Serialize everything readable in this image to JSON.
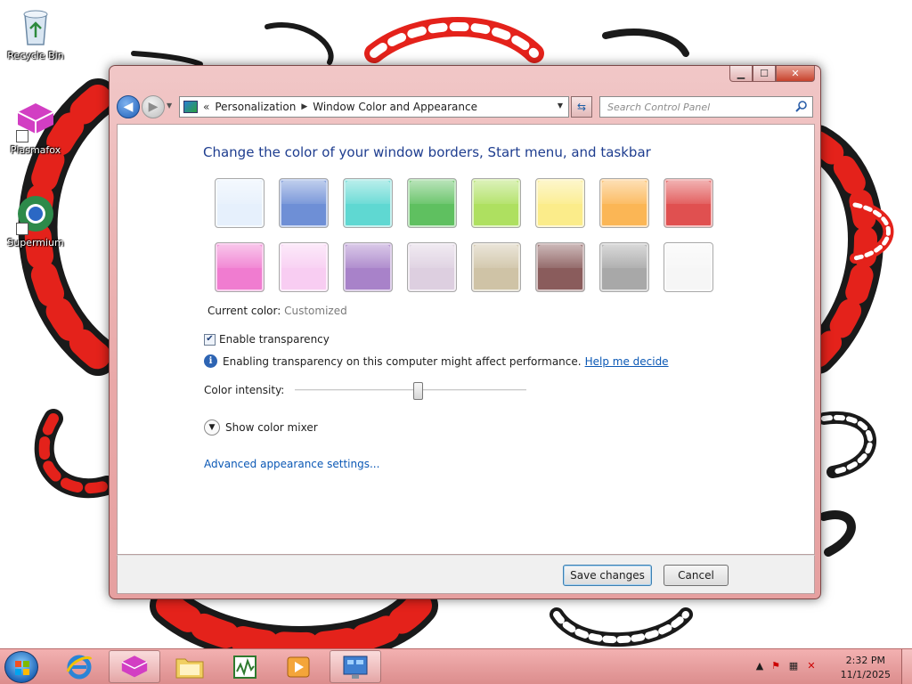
{
  "desktop": {
    "icons": [
      {
        "label": "Recycle Bin",
        "icon": "recycle-bin-icon"
      },
      {
        "label": "Plasmafox",
        "icon": "plasmafox-icon"
      },
      {
        "label": "Supermium",
        "icon": "supermium-icon"
      }
    ]
  },
  "window": {
    "controls": {
      "minimize": "▁",
      "maximize": "☐",
      "close": "✕"
    },
    "nav": {
      "breadcrumb_root": "Personalization",
      "breadcrumb_current": "Window Color and Appearance",
      "search_placeholder": "Search Control Panel"
    },
    "content": {
      "title": "Change the color of your window borders, Start menu, and taskbar",
      "swatch_colors": [
        "#e6f0fc",
        "#6e8fd6",
        "#5fd8d2",
        "#5fc060",
        "#aee060",
        "#fbec8a",
        "#fbb655",
        "#e05050",
        "#f07cd0",
        "#f8cdf2",
        "#a882c9",
        "#ddcfe0",
        "#cfc3a6",
        "#8a5c5c",
        "#a8a8a8",
        "#f6f6f6"
      ],
      "current_color_label": "Current color:",
      "current_color_value": "Customized",
      "enable_transparency_label": "Enable transparency",
      "enable_transparency_checked": true,
      "info_text": "Enabling transparency on this computer might affect performance.",
      "help_link": "Help me decide",
      "intensity_label": "Color intensity:",
      "intensity_fraction": 0.53,
      "mixer_label": "Show color mixer",
      "advanced_link": "Advanced appearance settings..."
    },
    "buttons": {
      "save": "Save changes",
      "cancel": "Cancel"
    }
  },
  "taskbar": {
    "items": [
      {
        "name": "internet-explorer",
        "active": false
      },
      {
        "name": "plasmafox",
        "active": true
      },
      {
        "name": "file-explorer",
        "active": false
      },
      {
        "name": "audio-editor",
        "active": false
      },
      {
        "name": "media-player",
        "active": false
      },
      {
        "name": "control-panel",
        "active": true
      }
    ],
    "clock_time": "2:32 PM",
    "clock_date": "11/1/2025"
  },
  "colors": {
    "accent": "#1e3d8f",
    "link": "#0b58b5",
    "window_frame": "#e9a8a8",
    "taskbar": "#e8a0a0"
  }
}
